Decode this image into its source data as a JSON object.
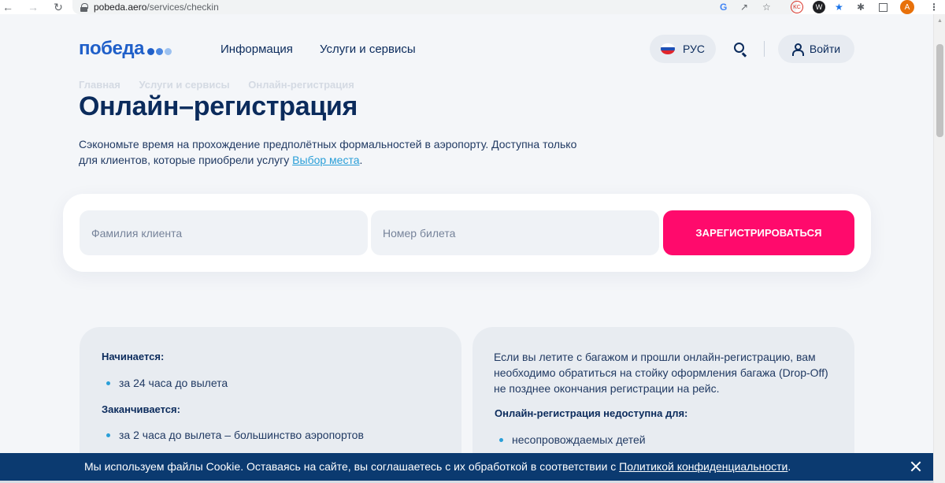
{
  "browser": {
    "url_host": "pobeda.aero",
    "url_path": "/services/checkin",
    "profile_initial": "A",
    "extensions": [
      "google-icon",
      "share-icon",
      "star-icon",
      "kc-extension-icon",
      "w-extension-icon",
      "blue-star-extension-icon",
      "puzzle-icon",
      "side-panel-icon"
    ]
  },
  "header": {
    "logo_text": "победа",
    "logo_dot_colors": [
      "#1f5fc9",
      "#4a86e0",
      "#9cc1f0"
    ],
    "nav": {
      "info": "Информация",
      "services": "Услуги и сервисы"
    },
    "language": "РУС",
    "login": "Войти"
  },
  "breadcrumb": [
    "Главная",
    "Услуги и сервисы",
    "Онлайн-регистрация"
  ],
  "main": {
    "title": "Онлайн–регистрация",
    "intro_text": "Сэкономьте время на прохождение предполётных формальностей в аэропорту. Доступна только для клиентов, которые приобрели услугу ",
    "intro_link": "Выбор места",
    "intro_end": "."
  },
  "form": {
    "surname_placeholder": "Фамилия клиента",
    "ticket_placeholder": "Номер билета",
    "submit_label": "ЗАРЕГИСТРИРОВАТЬСЯ"
  },
  "info_left": {
    "starts_heading": "Начинается:",
    "starts_item": "за 24 часа до вылета",
    "ends_heading": "Заканчивается:",
    "ends_item": "за 2 часа до вылета – большинство аэропортов"
  },
  "info_right": {
    "paragraph": "Если вы летите с багажом и прошли онлайн-регистрацию, вам необходимо обратиться на стойку оформления багажа (Drop-Off) не позднее окончания регистрации на рейс.",
    "unavailable_heading": "Онлайн-регистрация недоступна для:",
    "unavailable_item": "несопровождаемых детей"
  },
  "cookie": {
    "text": "Мы используем файлы Cookie. Оставаясь на сайте, вы соглашаетесь с их обработкой в соответствии с ",
    "link": "Политикой конфиденциальности",
    "end": "."
  },
  "colors": {
    "brand_blue": "#1f5fc9",
    "navy": "#0b2b5c",
    "accent_pink": "#ff0a6c",
    "link_blue": "#2a9fd8",
    "cookie_bg": "#0b3a70"
  }
}
